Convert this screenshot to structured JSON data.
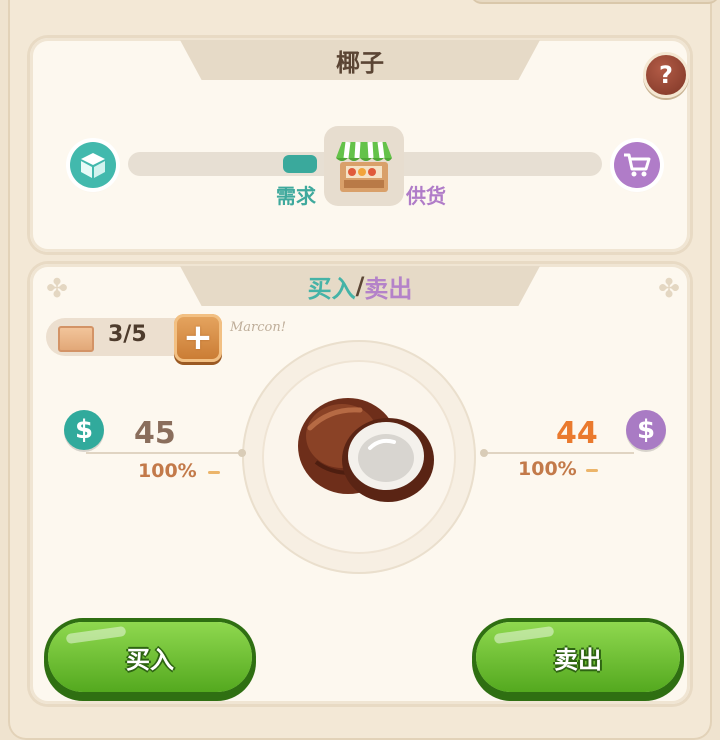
{
  "item": {
    "name": "椰子"
  },
  "help": {
    "label": "?"
  },
  "market": {
    "demand_label": "需求",
    "supply_label": "供货",
    "demand_level": 0.32
  },
  "trade": {
    "title_buy": "买入",
    "title_slash": "/",
    "title_sell": "卖出",
    "capacity": "3/5",
    "handwriting": "Marcon!",
    "buy_price": "45",
    "sell_price": "44",
    "buy_percent": "100%",
    "sell_percent": "100%",
    "currency_symbol": "$"
  },
  "buttons": {
    "buy": "买入",
    "sell": "卖出"
  },
  "colors": {
    "buy_accent": "#3aa99c",
    "sell_accent": "#b07cc8",
    "sell_price": "#ea7a2e",
    "action_green": "#6cbf2f"
  },
  "icons": [
    "box-icon",
    "cart-icon",
    "shop-stall-icon",
    "help-icon",
    "crate-icon",
    "plus-icon",
    "coin-icon",
    "coconut-icon"
  ]
}
